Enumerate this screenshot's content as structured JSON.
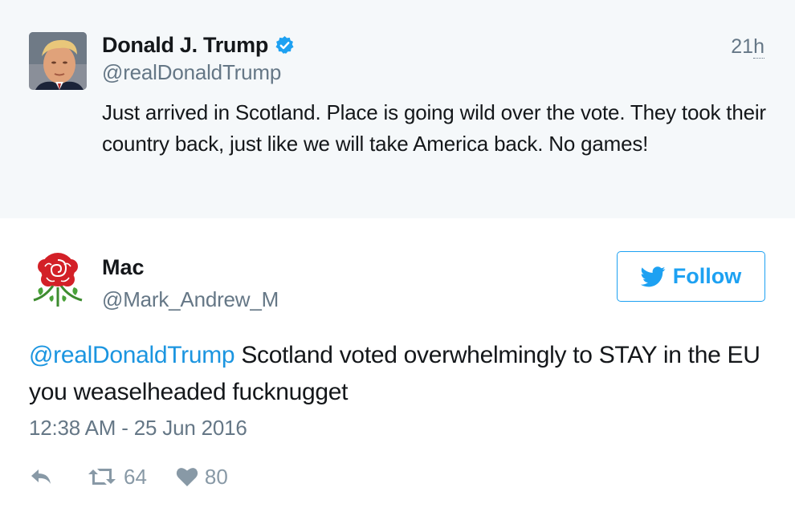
{
  "parent_tweet": {
    "author_name": "Donald J. Trump",
    "author_handle": "@realDonaldTrump",
    "verified": true,
    "time_ago_head": "21",
    "time_ago_tail": "h",
    "text": "Just arrived in Scotland. Place is going wild over the vote. They took their country back, just like we will take America back. No games!",
    "avatar_icon": "profile-photo",
    "verified_icon": "verified-badge-icon"
  },
  "tweet": {
    "author_name": "Mac",
    "author_handle": "@Mark_Andrew_M",
    "avatar_icon": "red-rose-icon",
    "follow_label": "Follow",
    "follow_icon": "bird-icon",
    "mention": "@realDonaldTrump",
    "text": " Scotland voted overwhelmingly to STAY in the EU you weaselheaded fucknugget",
    "timestamp": "12:38 AM - 25 Jun 2016",
    "retweet_count": "64",
    "like_count": "80",
    "action_icons": [
      "reply-icon",
      "retweet-icon",
      "heart-icon"
    ]
  },
  "colors": {
    "accent": "#1da1f2",
    "mention": "#1b95e0",
    "muted": "#657786",
    "parent_background": "#f5f8fa",
    "text": "#14171a"
  }
}
